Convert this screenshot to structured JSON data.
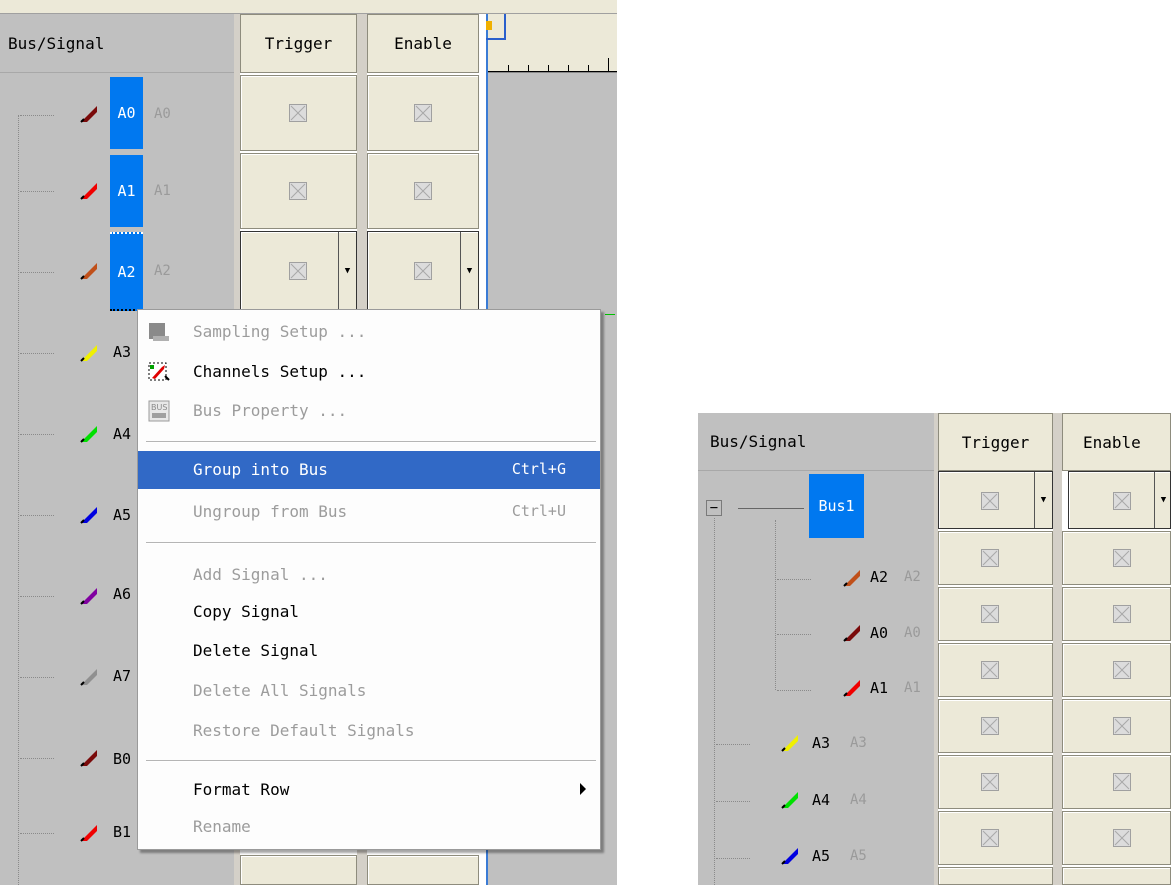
{
  "left": {
    "header": {
      "bus_signal": "Bus/Signal",
      "trigger": "Trigger",
      "enable": "Enable"
    },
    "signals": [
      {
        "label": "A0",
        "ghost": "A0",
        "color": "#7a0a0a"
      },
      {
        "label": "A1",
        "ghost": "A1",
        "color": "#f00000"
      },
      {
        "label": "A2",
        "ghost": "A2",
        "color": "#c0501a"
      },
      {
        "label": "A3",
        "ghost": "",
        "color": "#f0f000"
      },
      {
        "label": "A4",
        "ghost": "",
        "color": "#00e000"
      },
      {
        "label": "A5",
        "ghost": "",
        "color": "#0000e0"
      },
      {
        "label": "A6",
        "ghost": "",
        "color": "#8000a0"
      },
      {
        "label": "A7",
        "ghost": "",
        "color": "#909090"
      },
      {
        "label": "B0",
        "ghost": "",
        "color": "#7a0a0a"
      },
      {
        "label": "B1",
        "ghost": "",
        "color": "#f00000"
      }
    ]
  },
  "context_menu": {
    "items": [
      {
        "label": "Sampling Setup ...",
        "shortcut": "",
        "disabled": true,
        "icon": "sampling-setup-icon"
      },
      {
        "label": "Channels Setup ...",
        "shortcut": "",
        "disabled": false,
        "icon": "channels-setup-icon"
      },
      {
        "label": "Bus Property ...",
        "shortcut": "",
        "disabled": true,
        "icon": "bus-property-icon"
      },
      {
        "label": "Group into Bus",
        "shortcut": "Ctrl+G",
        "disabled": false,
        "highlighted": true
      },
      {
        "label": "Ungroup from Bus",
        "shortcut": "Ctrl+U",
        "disabled": true
      },
      {
        "label": "Add Signal ...",
        "shortcut": "",
        "disabled": true
      },
      {
        "label": "Copy Signal",
        "shortcut": "",
        "disabled": false
      },
      {
        "label": "Delete Signal",
        "shortcut": "",
        "disabled": false
      },
      {
        "label": "Delete All Signals",
        "shortcut": "",
        "disabled": true
      },
      {
        "label": "Restore Default Signals",
        "shortcut": "",
        "disabled": true
      },
      {
        "label": "Format Row",
        "shortcut": "",
        "disabled": false,
        "submenu": true
      },
      {
        "label": "Rename",
        "shortcut": "",
        "disabled": true
      }
    ]
  },
  "right": {
    "header": {
      "bus_signal": "Bus/Signal",
      "trigger": "Trigger",
      "enable": "Enable"
    },
    "bus": {
      "label": "Bus1",
      "collapse_symbol": "−"
    },
    "signals": [
      {
        "label": "A2",
        "ghost": "A2",
        "color": "#c0501a"
      },
      {
        "label": "A0",
        "ghost": "A0",
        "color": "#7a0a0a"
      },
      {
        "label": "A1",
        "ghost": "A1",
        "color": "#f00000"
      },
      {
        "label": "A3",
        "ghost": "A3",
        "color": "#f0f000"
      },
      {
        "label": "A4",
        "ghost": "A4",
        "color": "#00e000"
      },
      {
        "label": "A5",
        "ghost": "A5",
        "color": "#0000e0"
      }
    ]
  },
  "icons": {
    "dropdown": "▼",
    "checkbox": "x-checkbox-icon"
  }
}
